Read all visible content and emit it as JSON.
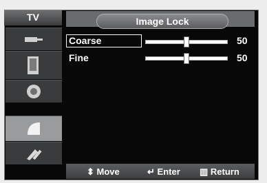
{
  "header": {
    "left_label": "TV",
    "title": "Image Lock"
  },
  "sidebar": {
    "items": [
      {
        "icon": "input-plug-icon"
      },
      {
        "icon": "picture-icon"
      },
      {
        "icon": "speaker-icon"
      },
      {
        "icon": "satellite-dish-icon",
        "selected": true
      },
      {
        "icon": "setup-tools-icon"
      }
    ]
  },
  "items": [
    {
      "label": "Coarse",
      "value": "50"
    },
    {
      "label": "Fine",
      "value": "50"
    }
  ],
  "footer": {
    "move": "Move",
    "enter": "Enter",
    "return": "Return"
  }
}
